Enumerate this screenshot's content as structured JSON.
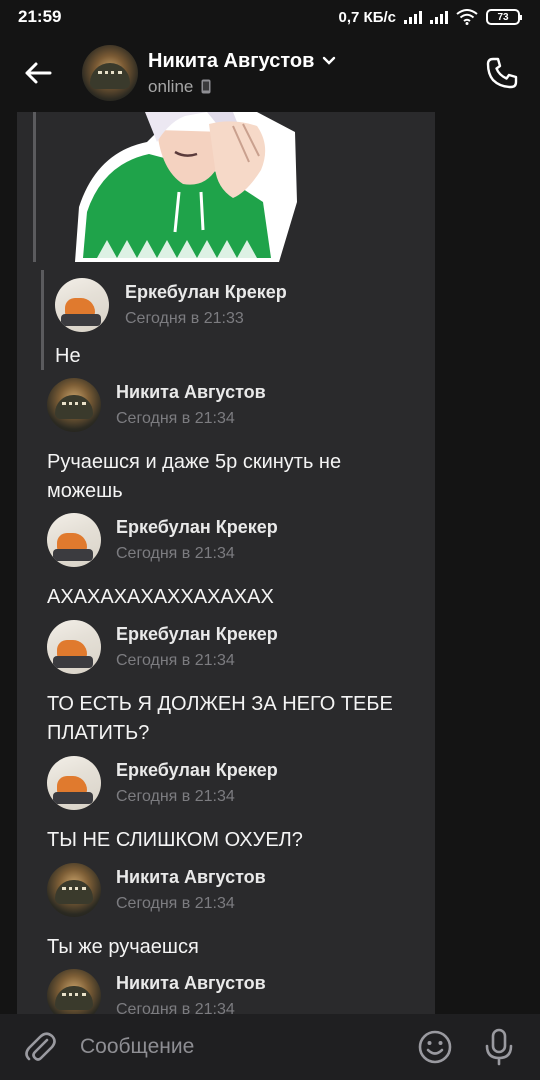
{
  "status_bar": {
    "time": "21:59",
    "network_speed": "0,7 КБ/с",
    "battery": "73"
  },
  "header": {
    "contact_name": "Никита Августов",
    "status": "online"
  },
  "quote": {
    "author": "Еркебулан Крекер",
    "time": "Сегодня в 21:33",
    "text": "Не"
  },
  "messages": [
    {
      "author": "Никита Августов",
      "time": "Сегодня в 21:34",
      "text": "Ручаешся и даже 5р скинуть не можешь"
    },
    {
      "author": "Еркебулан Крекер",
      "time": "Сегодня в 21:34",
      "text": "АХАХАХАХАХХАХАХАХ"
    },
    {
      "author": "Еркебулан Крекер",
      "time": "Сегодня в 21:34",
      "text": "ТО ЕСТЬ Я ДОЛЖЕН ЗА НЕГО ТЕБЕ ПЛАТИТЬ?"
    },
    {
      "author": "Еркебулан Крекер",
      "time": "Сегодня в 21:34",
      "text": "ТЫ НЕ СЛИШКОМ ОХУЕЛ?"
    },
    {
      "author": "Никита Августов",
      "time": "Сегодня в 21:34",
      "text": "Ты же ручаешся"
    },
    {
      "author": "Никита Августов",
      "time": "Сегодня в 21:34",
      "text": ""
    }
  ],
  "input": {
    "placeholder": "Сообщение"
  },
  "colors": {
    "background": "#141414",
    "thread_background": "#2a2a2c",
    "accent_green": "#1fa34a"
  }
}
